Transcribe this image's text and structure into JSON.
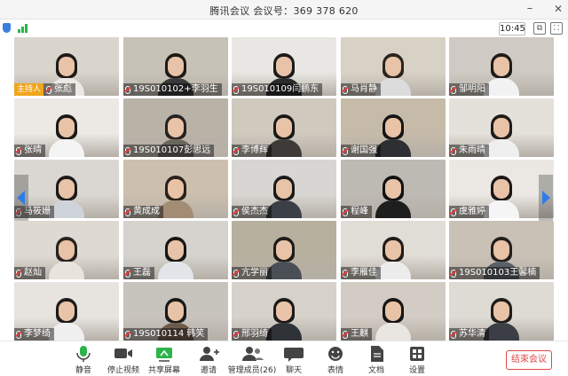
{
  "window": {
    "title": "腾讯会议  会议号：369 378 620"
  },
  "toolbar": {
    "timer": "10:45"
  },
  "participants": [
    {
      "name": "张彪",
      "host": true,
      "host_label": "主持人",
      "bg": "#d9d5cc",
      "hair": "#1c1a18",
      "shirt": "#ece9e4"
    },
    {
      "name": "19S010102+李羽生",
      "bg": "#c7c2b8",
      "hair": "#1d1a17",
      "shirt": "#3a3a3a"
    },
    {
      "name": "19S010109闫鹏东",
      "bg": "#e9e7e3",
      "hair": "#1b1b1b",
      "shirt": "#2b2b2b"
    },
    {
      "name": "马肖静",
      "bg": "#d8d2c6",
      "hair": "#2a2420",
      "shirt": "#dcdcdc"
    },
    {
      "name": "邹明阳",
      "bg": "#cfcac3",
      "hair": "#1e1b18",
      "shirt": "#f2f2f2"
    },
    {
      "name": "张晴",
      "bg": "#ece9e5",
      "hair": "#1a1816",
      "shirt": "#f4f4f4"
    },
    {
      "name": "19S010107彭思远",
      "bg": "#b9b2a7",
      "hair": "#262220",
      "shirt": "#6b6560"
    },
    {
      "name": "李博辉",
      "bg": "#cfc9be",
      "hair": "#1b1917",
      "shirt": "#3d3a38"
    },
    {
      "name": "谢国强",
      "bg": "#c6bba9",
      "hair": "#161514",
      "shirt": "#2e2f33"
    },
    {
      "name": "朱雨晴",
      "bg": "#e4e0da",
      "hair": "#1f1c1a",
      "shirt": "#efefef"
    },
    {
      "name": "马筱姗",
      "bg": "#dad7d2",
      "hair": "#1c1a19",
      "shirt": "#cfd4da"
    },
    {
      "name": "黄成成",
      "bg": "#cdbfae",
      "hair": "#2a211a",
      "shirt": "#a28c73"
    },
    {
      "name": "侯杰杰",
      "bg": "#d8d6d2",
      "hair": "#19181a",
      "shirt": "#3b3f46"
    },
    {
      "name": "程峰",
      "bg": "#bdb9b3",
      "hair": "#111111",
      "shirt": "#1e1e1e"
    },
    {
      "name": "虞雅婷",
      "bg": "#ebe8e4",
      "hair": "#1a1716",
      "shirt": "#f5f5f5"
    },
    {
      "name": "赵灿",
      "bg": "#ded9d2",
      "hair": "#262220",
      "shirt": "#e8e3dc"
    },
    {
      "name": "王磊",
      "bg": "#d6d3cf",
      "hair": "#161616",
      "shirt": "#e2e6ea"
    },
    {
      "name": "亢学丽",
      "bg": "#b8b09f",
      "hair": "#1d1b19",
      "shirt": "#4a4f55"
    },
    {
      "name": "李雁佳",
      "bg": "#e0dcd6",
      "hair": "#201c19",
      "shirt": "#ececec"
    },
    {
      "name": "19S010103王馨楠",
      "bg": "#c9c1b6",
      "hair": "#221e1b",
      "shirt": "#5b5f66"
    },
    {
      "name": "李梦绮",
      "bg": "#e7e4e0",
      "hair": "#1d1a18",
      "shirt": "#f0f0f0"
    },
    {
      "name": "19S010114 韩笑",
      "bg": "#c7c3bd",
      "hair": "#1a1818",
      "shirt": "#6e5a4b"
    },
    {
      "name": "邢羽绮",
      "bg": "#d6d1ca",
      "hair": "#1b1918",
      "shirt": "#2f3237"
    },
    {
      "name": "王麒",
      "bg": "#d2ccc4",
      "hair": "#161514",
      "shirt": "#e9e6e2"
    },
    {
      "name": "苏华清",
      "bg": "#dedad4",
      "hair": "#1f1c1a",
      "shirt": "#3b3e44"
    }
  ],
  "bottom_bar": {
    "mute": "静音",
    "stop_video": "停止视频",
    "share_screen": "共享屏幕",
    "invite": "邀请",
    "manage_members": "管理成员(26)",
    "chat": "聊天",
    "reactions": "表情",
    "documents": "文档",
    "settings": "设置",
    "end_meeting": "结束会议"
  },
  "colors": {
    "accent": "#2f7ce6",
    "danger": "#e04848",
    "host_badge": "#f0a51c"
  }
}
